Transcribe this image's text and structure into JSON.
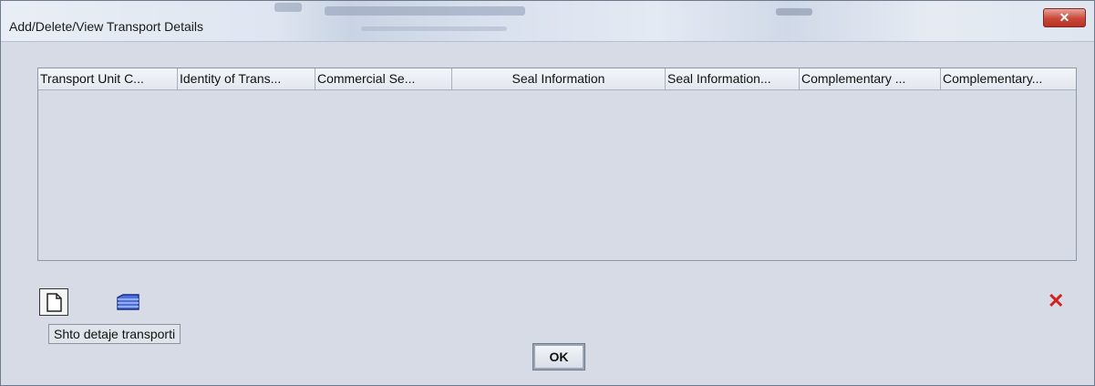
{
  "window": {
    "title": "Add/Delete/View Transport Details",
    "close_glyph": "✕"
  },
  "table": {
    "columns": [
      "Transport Unit C...",
      "Identity of Trans...",
      "Commercial Se...",
      "Seal Information",
      "Seal Information...",
      "Complementary ...",
      "Complementary..."
    ],
    "rows": []
  },
  "toolbar": {
    "new_icon": "new-document-icon",
    "open_icon": "folder-icon",
    "tooltip": "Shto detaje transporti",
    "delete_icon": "delete-icon",
    "delete_glyph": "✕"
  },
  "footer": {
    "ok_label": "OK"
  },
  "colors": {
    "background": "#d6dbe6",
    "close_button": "#c9473a",
    "delete": "#d42020"
  }
}
